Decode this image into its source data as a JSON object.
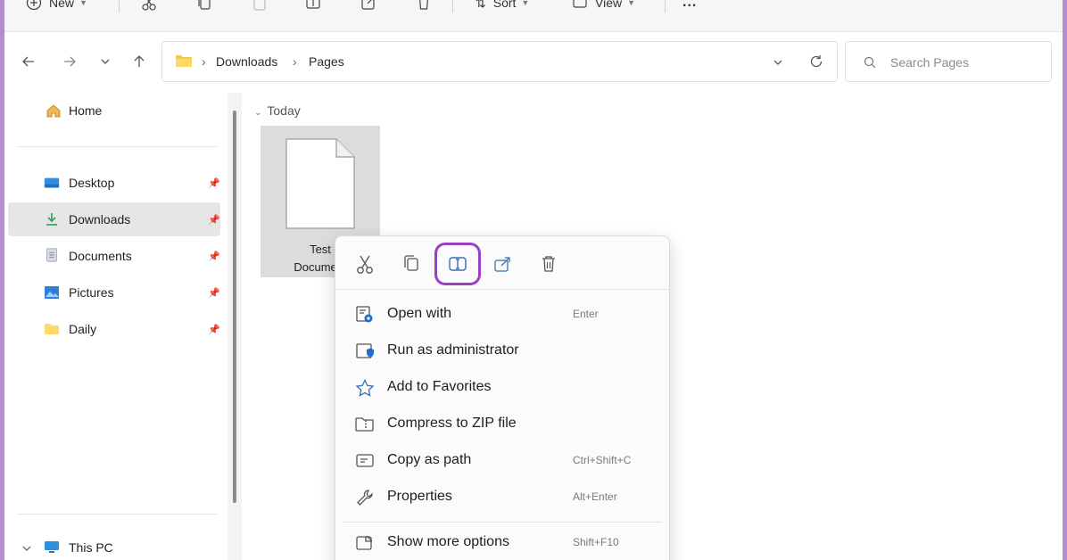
{
  "toolbar": {
    "new_label": "New",
    "sort_label": "Sort",
    "view_label": "View",
    "more_label": "..."
  },
  "address": {
    "breadcrumbs": [
      "Downloads",
      "Pages"
    ],
    "search_placeholder": "Search Pages"
  },
  "sidebar": {
    "home": "Home",
    "items": [
      {
        "label": "Desktop",
        "icon": "desktop-icon"
      },
      {
        "label": "Downloads",
        "icon": "download-icon"
      },
      {
        "label": "Documents",
        "icon": "documents-icon"
      },
      {
        "label": "Pictures",
        "icon": "pictures-icon"
      },
      {
        "label": "Daily",
        "icon": "folder-icon"
      }
    ],
    "this_pc": "This PC",
    "selected": "Downloads"
  },
  "content": {
    "group_header": "Today",
    "file": {
      "line1": "Test",
      "line2": "Document"
    }
  },
  "context_menu": {
    "quick_actions": [
      "cut",
      "copy",
      "rename",
      "share",
      "delete"
    ],
    "highlighted_action": "rename",
    "items": [
      {
        "label": "Open with",
        "shortcut": "Enter"
      },
      {
        "label": "Run as administrator",
        "shortcut": ""
      },
      {
        "label": "Add to Favorites",
        "shortcut": ""
      },
      {
        "label": "Compress to ZIP file",
        "shortcut": ""
      },
      {
        "label": "Copy as path",
        "shortcut": "Ctrl+Shift+C"
      },
      {
        "label": "Properties",
        "shortcut": "Alt+Enter"
      }
    ],
    "more": {
      "label": "Show more options",
      "shortcut": "Shift+F10"
    }
  },
  "colors": {
    "frame": "#b58ccc",
    "highlight": "#9b3fc6",
    "selected_bg": "#e6e6e6"
  }
}
